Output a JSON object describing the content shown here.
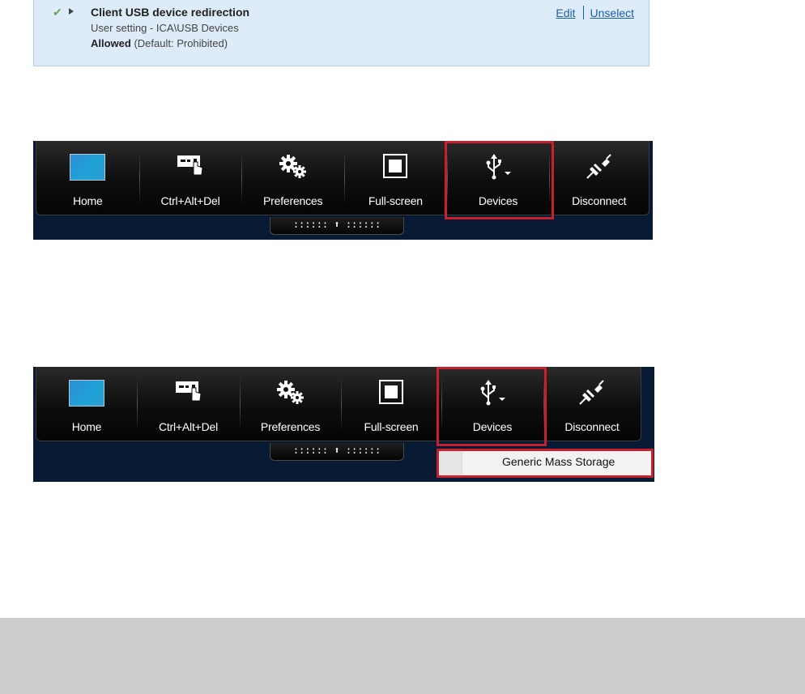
{
  "policy": {
    "title": "Client USB device redirection",
    "subtitle": "User setting - ICA\\USB Devices",
    "state_value": "Allowed",
    "state_default": " (Default: Prohibited)",
    "edit_label": "Edit",
    "unselect_label": "Unselect"
  },
  "toolbar1": {
    "buttons": [
      {
        "label": "Home",
        "icon": "home-icon"
      },
      {
        "label": "Ctrl+Alt+Del",
        "icon": "ctrl-alt-del-icon"
      },
      {
        "label": "Preferences",
        "icon": "gears-icon"
      },
      {
        "label": "Full-screen",
        "icon": "fullscreen-icon"
      },
      {
        "label": "Devices",
        "icon": "usb-icon"
      },
      {
        "label": "Disconnect",
        "icon": "plug-icon"
      }
    ],
    "handle": ":::::: ⬆ ::::::"
  },
  "toolbar2": {
    "buttons": [
      {
        "label": "Home",
        "icon": "home-icon"
      },
      {
        "label": "Ctrl+Alt+Del",
        "icon": "ctrl-alt-del-icon"
      },
      {
        "label": "Preferences",
        "icon": "gears-icon"
      },
      {
        "label": "Full-screen",
        "icon": "fullscreen-icon"
      },
      {
        "label": "Devices",
        "icon": "usb-icon"
      },
      {
        "label": "Disconnect",
        "icon": "plug-icon"
      }
    ],
    "handle": ":::::: ⬆ ::::::",
    "devices_menu": [
      "Generic Mass Storage"
    ]
  },
  "colors": {
    "highlight": "#c8202e",
    "panel_bg": "#deebf9",
    "link": "#1a5fb4",
    "toolbar_bg": "#0d0d0d",
    "desktop_bg": "#081a33"
  }
}
